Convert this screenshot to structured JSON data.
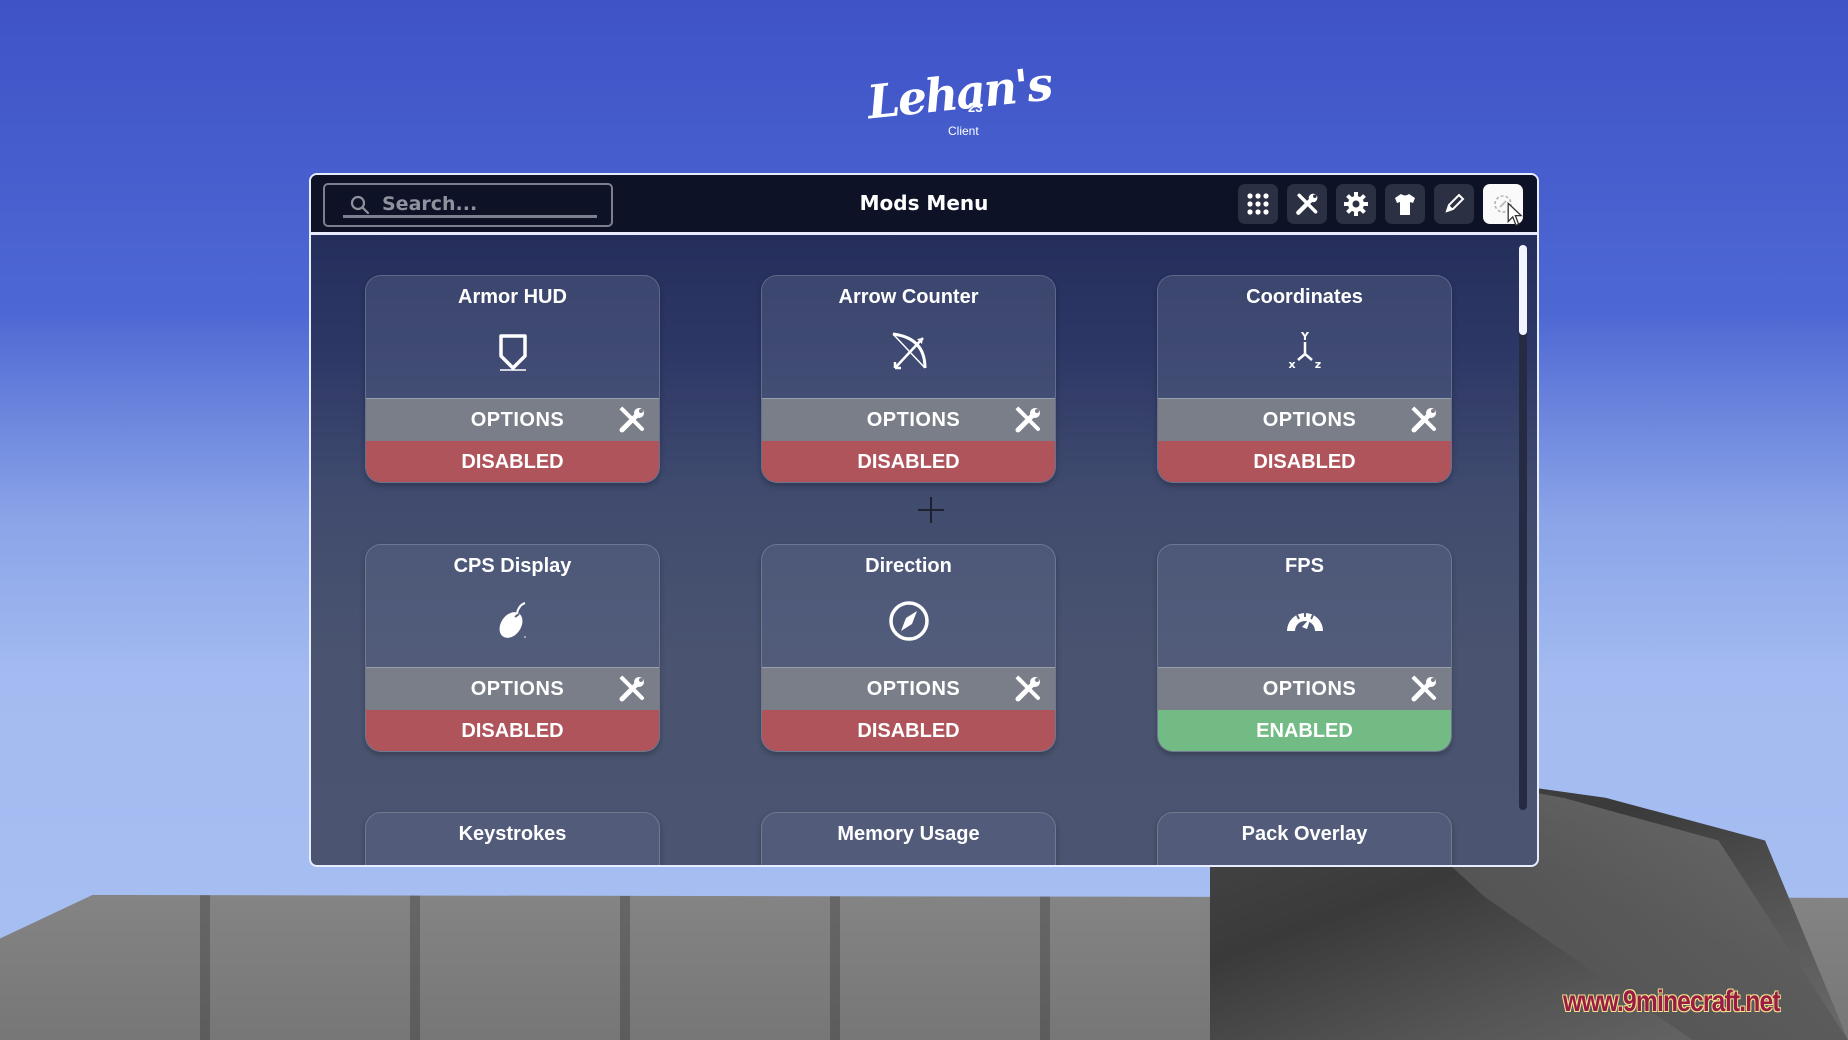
{
  "logo": {
    "script": "Lehan's",
    "number": "23",
    "subtitle": "Client"
  },
  "header": {
    "title": "Mods Menu",
    "search": {
      "placeholder": "Search...",
      "value": ""
    },
    "toolbar": [
      {
        "icon": "grid-icon",
        "label": "Mods"
      },
      {
        "icon": "tools-icon",
        "label": "Tools"
      },
      {
        "icon": "gear-icon",
        "label": "Settings"
      },
      {
        "icon": "shirt-icon",
        "label": "Cosmetics"
      },
      {
        "icon": "pencil-icon",
        "label": "Edit HUD"
      },
      {
        "icon": "profile-icon",
        "label": "Profile",
        "active": true
      }
    ]
  },
  "mods": [
    {
      "name": "Armor HUD",
      "icon": "shield-icon",
      "options_label": "OPTIONS",
      "status": "DISABLED",
      "enabled": false
    },
    {
      "name": "Arrow Counter",
      "icon": "bow-arrow-icon",
      "options_label": "OPTIONS",
      "status": "DISABLED",
      "enabled": false
    },
    {
      "name": "Coordinates",
      "icon": "xyz-axes-icon",
      "options_label": "OPTIONS",
      "status": "DISABLED",
      "enabled": false
    },
    {
      "name": "CPS Display",
      "icon": "mouse-icon",
      "options_label": "OPTIONS",
      "status": "DISABLED",
      "enabled": false
    },
    {
      "name": "Direction",
      "icon": "compass-icon",
      "options_label": "OPTIONS",
      "status": "DISABLED",
      "enabled": false
    },
    {
      "name": "FPS",
      "icon": "speedometer-icon",
      "options_label": "OPTIONS",
      "status": "ENABLED",
      "enabled": true
    },
    {
      "name": "Keystrokes"
    },
    {
      "name": "Memory Usage"
    },
    {
      "name": "Pack Overlay"
    }
  ],
  "colors": {
    "disabled": "#b0545c",
    "enabled": "#72bb84",
    "options": "#7a7e89",
    "header_bg": "#0d1226"
  },
  "watermark": "www.9minecraft.net"
}
